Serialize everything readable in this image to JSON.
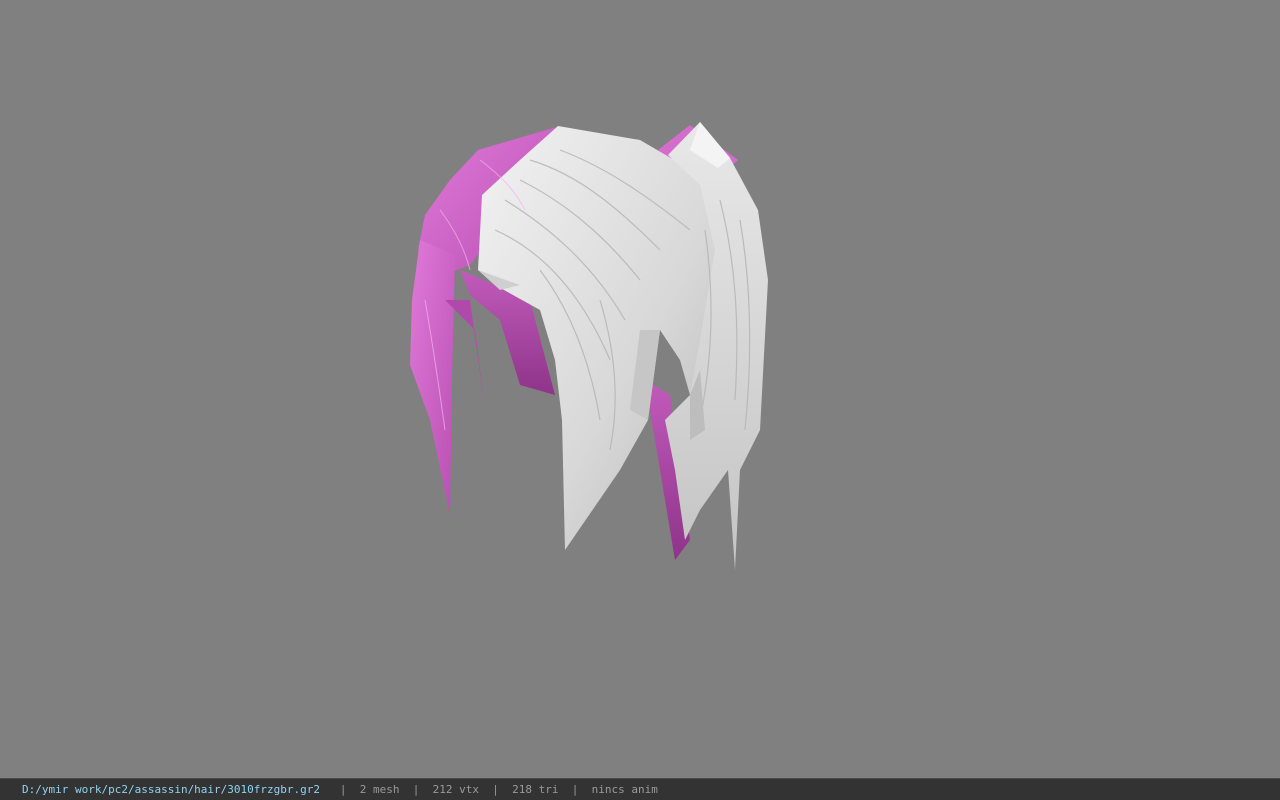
{
  "viewport": {
    "background": "#808080",
    "model": "hair-mesh",
    "colors": {
      "hair_white": "#e6e6e6",
      "hair_shade": "#bdbdbd",
      "hair_pink": "#d96ad2",
      "hair_pink_dark": "#a23f9c"
    }
  },
  "status": {
    "path": "D:/ymir work/pc2/assassin/hair/3010frzgbr.gr2",
    "separator": "|",
    "mesh": "2 mesh",
    "vtx": "212 vtx",
    "tri": "218 tri",
    "anim": "nincs anim"
  }
}
